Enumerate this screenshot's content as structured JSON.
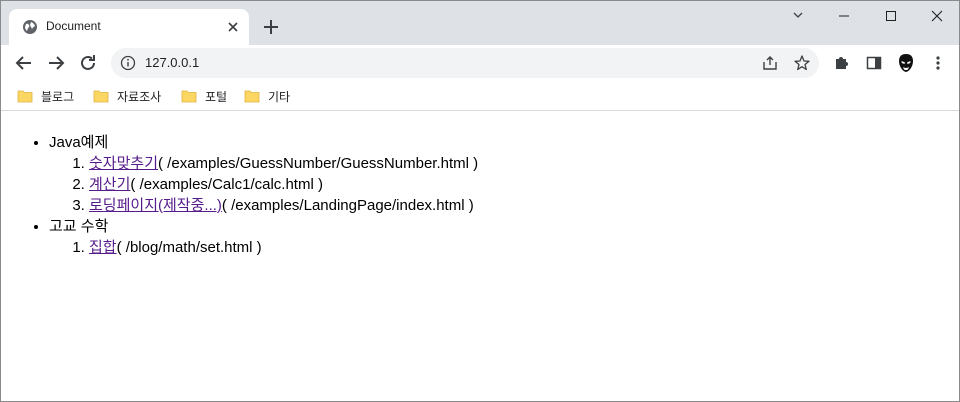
{
  "browser": {
    "tab": {
      "title": "Document"
    },
    "omnibox": {
      "url": "127.0.0.1"
    },
    "bookmarks": [
      {
        "label": "블로그"
      },
      {
        "label": "자료조사"
      },
      {
        "label": "포털"
      },
      {
        "label": "기타"
      }
    ]
  },
  "page": {
    "sections": [
      {
        "title": "Java예제",
        "items": [
          {
            "link": "숫자맞추기",
            "path": "( /examples/GuessNumber/GuessNumber.html )"
          },
          {
            "link": "계산기",
            "path": "( /examples/Calc1/calc.html )"
          },
          {
            "link": "로딩페이지(제작중...)",
            "path": "( /examples/LandingPage/index.html )"
          }
        ]
      },
      {
        "title": "고교 수학",
        "items": [
          {
            "link": "집합",
            "path": "( /blog/math/set.html )"
          }
        ]
      }
    ]
  },
  "colors": {
    "tabstrip_bg": "#dee1e6",
    "visited_link": "#551a8b",
    "folder_yellow": "#fcd663"
  },
  "icons": {
    "favicon": "globe-icon",
    "tab_close": "close-icon",
    "new_tab": "plus-icon",
    "back": "back-arrow-icon",
    "forward": "forward-arrow-icon",
    "reload": "reload-icon",
    "info": "info-icon",
    "share": "share-icon",
    "bookmark_star": "star-icon",
    "extensions": "puzzle-icon",
    "side_panel": "side-panel-icon",
    "profile": "profile-avatar-icon",
    "menu": "kebab-menu-icon",
    "folder": "folder-icon"
  }
}
